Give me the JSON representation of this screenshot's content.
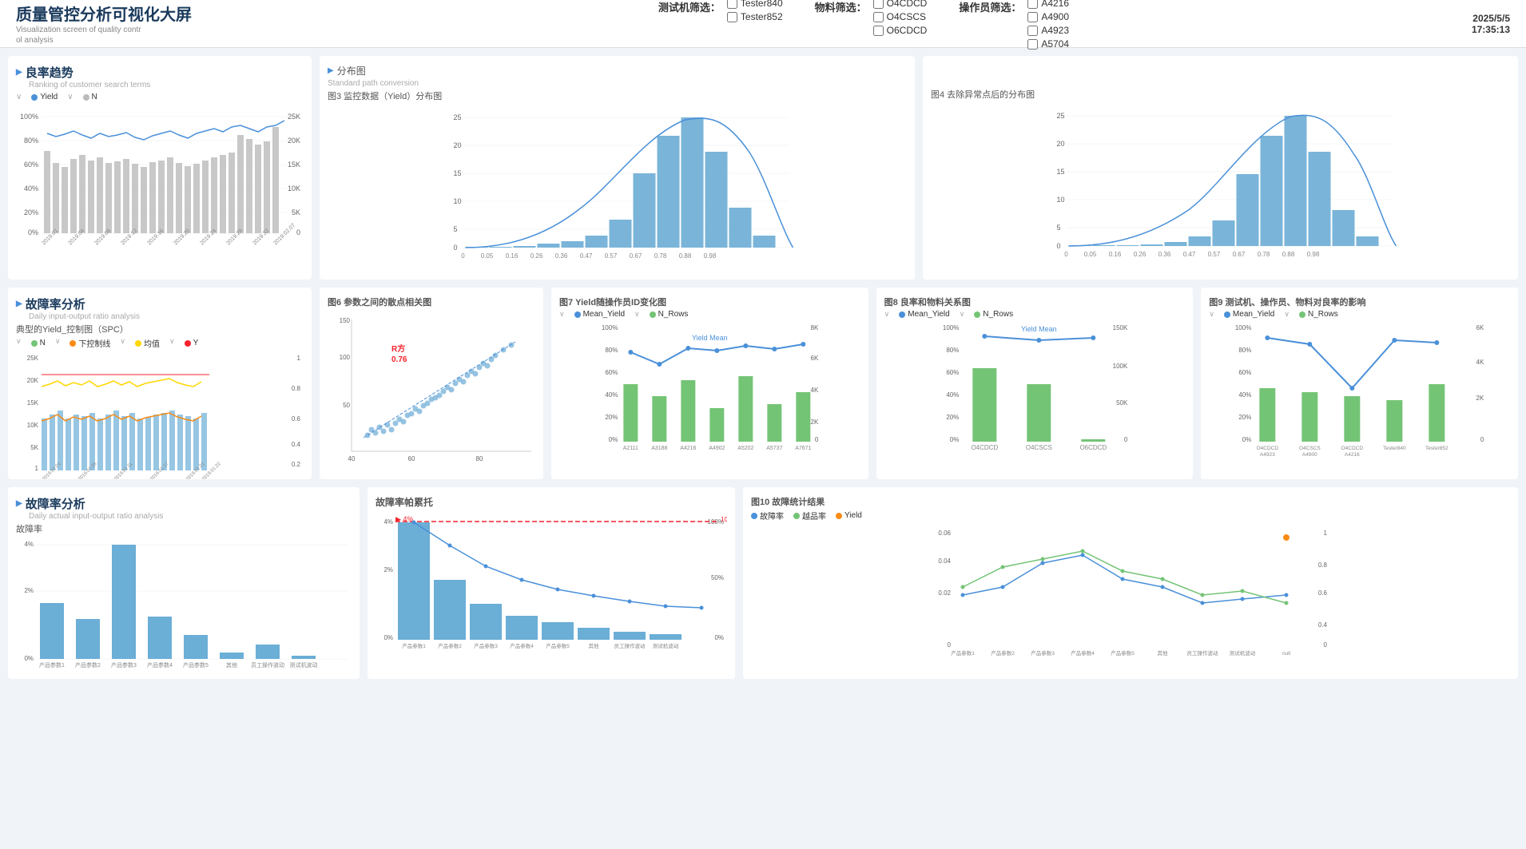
{
  "header": {
    "title_zh": "质量管控分析可视化大屏",
    "title_en": "Visualization screen of quality contr\nol analysis",
    "datetime": "2025/5/5\n17:35:13",
    "filters": {
      "tester_label": "测试机筛选：",
      "tester_options": [
        "Tester840",
        "Tester852"
      ],
      "material_label": "物料筛选：",
      "material_options": [
        "O4CDCD",
        "O4CSCS",
        "O6CDCD"
      ],
      "operator_label": "操作员筛选：",
      "operator_options": [
        "A4216",
        "A4900",
        "A4923",
        "A5704"
      ]
    }
  },
  "sections": {
    "yield_trend": {
      "title_zh": "良率趋势",
      "title_en": "Ranking of customer search terms",
      "legend": [
        "Yield",
        "N"
      ]
    },
    "distribution": {
      "title_zh": "分布图",
      "title_en": "Standard path conversion",
      "chart3_label": "图3  监控数据（Yield）分布图",
      "chart4_label": "图4  去除异常点后的分布图"
    },
    "fault_analysis1": {
      "title_zh": "故障率分析",
      "title_en": "Daily input-output ratio analysis"
    },
    "spc_chart": {
      "title": "典型的Yield_控制图（SPC）",
      "legend": [
        "N",
        "下控制线",
        "均值",
        "Y"
      ]
    },
    "scatter_chart": {
      "title": "图6  参数之间的散点相关图",
      "r_sq": "R方\n0.76"
    },
    "yield_operator": {
      "title": "图7  Yield随操作员ID变化图",
      "legend": [
        "Mean_Yield",
        "N_Rows"
      ],
      "categories": [
        "A2111",
        "A3188",
        "A4216",
        "A4902",
        "A5202",
        "A5737",
        "A7671"
      ]
    },
    "yield_material": {
      "title": "图8  良率和物料关系图",
      "legend": [
        "Mean_Yield",
        "N_Rows"
      ],
      "categories": [
        "O4CDCD",
        "O4CSCS",
        "O6CDCD"
      ]
    },
    "yield_machine": {
      "title": "图9  测试机、操作员、物料对良率的影响",
      "legend": [
        "Mean_Yield",
        "N_Rows"
      ],
      "categories": [
        "O4CDCD\nA4923",
        "O4CSCS\nA4900",
        "O4CDCD\nA4216",
        "Tester840",
        "Tester852"
      ]
    },
    "fault_analysis2": {
      "title_zh": "故障率分析",
      "title_en": "Daily actual input-output ratio analysis"
    },
    "fault_rate_chart": {
      "title": "故障率",
      "categories": [
        "产品参数1",
        "产品参数2",
        "产品参数3",
        "产品参数4",
        "产品参数5",
        "其他",
        "员工操作波动",
        "测试机波动"
      ],
      "values": [
        1.8,
        1.2,
        4.0,
        1.3,
        0.8,
        0.3,
        0.5,
        0.2
      ]
    },
    "pareto_chart": {
      "title": "故障率帕累托",
      "threshold": "4%",
      "threshold_line": "100%"
    },
    "fault_stats": {
      "title": "图10  故障统计结果",
      "legend": [
        "故障率",
        "越品率",
        "Yield"
      ],
      "categories": [
        "产品参数1",
        "产品参数2",
        "产品参数3",
        "产品参数4",
        "产品参数5",
        "其他",
        "员工操作波动",
        "测试机波动",
        "null"
      ]
    }
  },
  "colors": {
    "blue": "#4a90d9",
    "light_blue": "#9ac5e8",
    "green": "#52c41a",
    "orange": "#fa8c16",
    "red": "#f5222d",
    "gray": "#bfbfbf",
    "bar_blue": "#6baed6",
    "bar_green": "#74c476",
    "accent": "#1a3a5c"
  }
}
